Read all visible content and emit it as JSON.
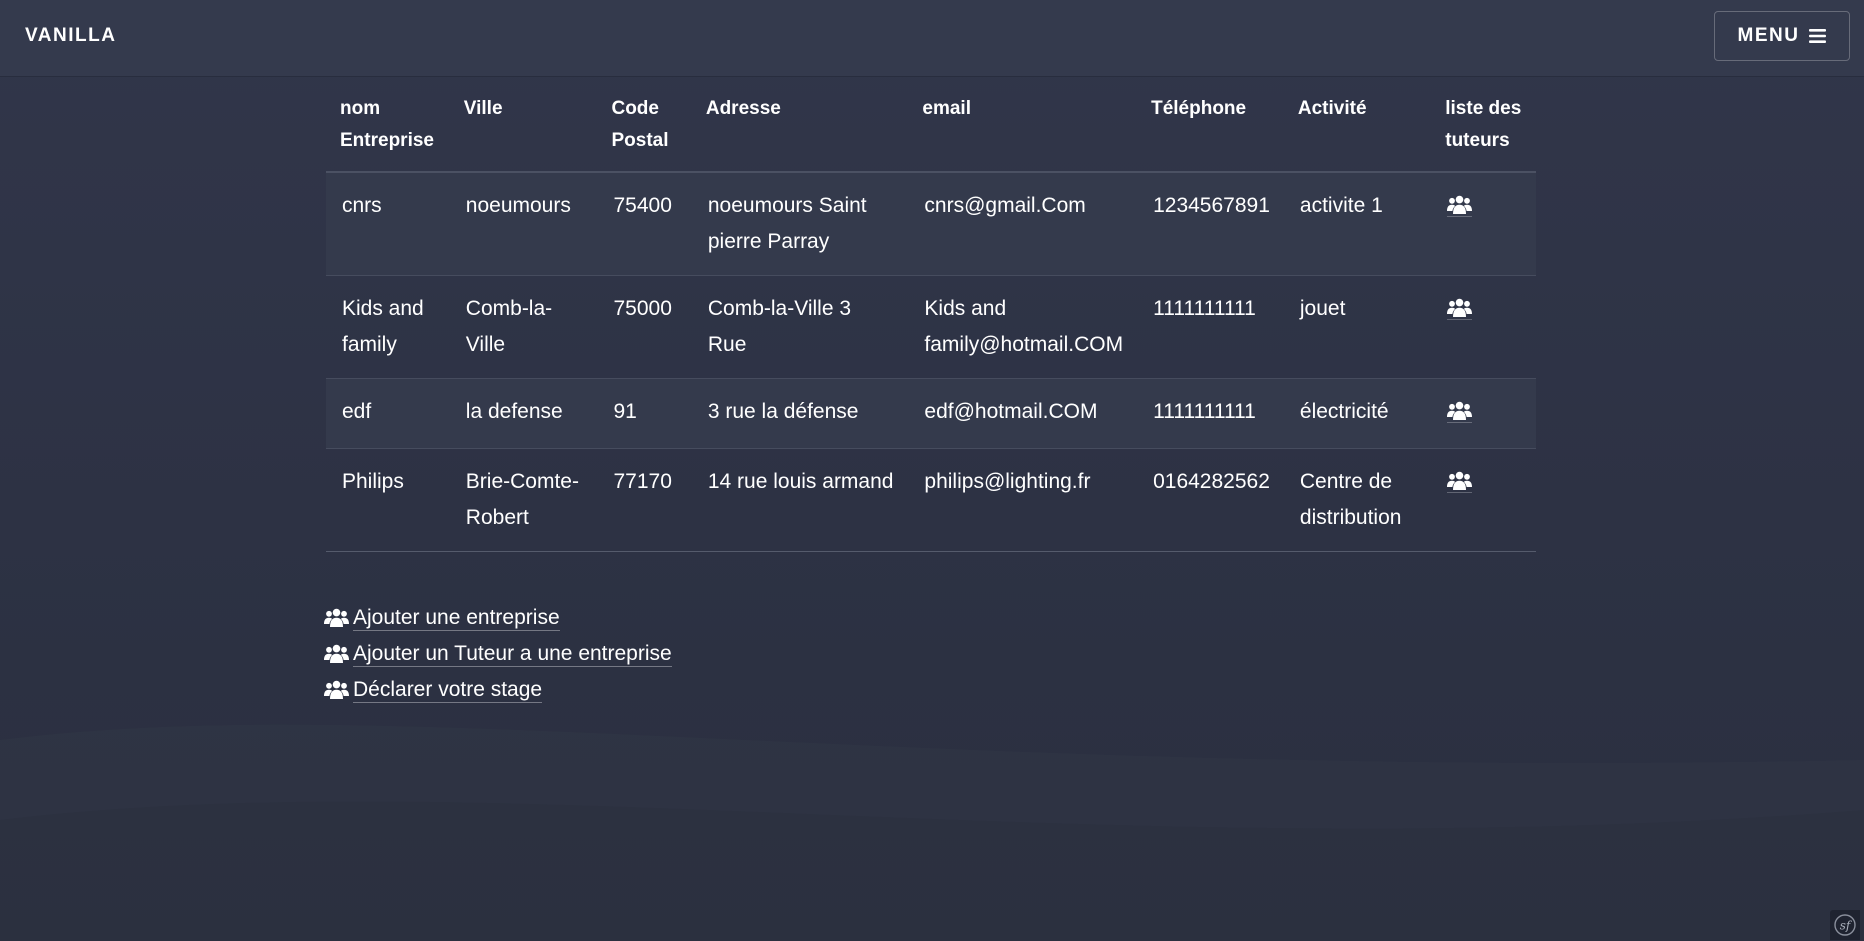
{
  "navbar": {
    "brand": "VANILLA",
    "menu_label": "MENU",
    "menu_icon": "hamburger-icon"
  },
  "table": {
    "headers": [
      "nom Entreprise",
      "Ville",
      "Code Postal",
      "Adresse",
      "email",
      "Téléphone",
      "Activité",
      "liste des tuteurs"
    ],
    "rows": [
      {
        "nom": "cnrs",
        "ville": "noeumours",
        "code": "75400",
        "adresse": "noeumours Saint pierre Parray",
        "email": "cnrs@gmail.Com",
        "tel": "1234567891",
        "activite": "activite 1",
        "tuteurs_icon": "users-icon"
      },
      {
        "nom": "Kids and family",
        "ville": "Comb-la-Ville",
        "code": "75000",
        "adresse": "Comb-la-Ville 3 Rue",
        "email": "Kids and family@hotmail.COM",
        "tel": "1111111111",
        "activite": "jouet",
        "tuteurs_icon": "users-icon"
      },
      {
        "nom": "edf",
        "ville": "la defense",
        "code": "91",
        "adresse": "3 rue la défense",
        "email": "edf@hotmail.COM",
        "tel": "1111111111",
        "activite": "électricité",
        "tuteurs_icon": "users-icon"
      },
      {
        "nom": "Philips",
        "ville": "Brie-Comte-Robert",
        "code": "77170",
        "adresse": "14 rue louis armand",
        "email": "philips@lighting.fr",
        "tel": "0164282562",
        "activite": "Centre de distribution",
        "tuteurs_icon": "users-icon"
      }
    ]
  },
  "actions": [
    {
      "label": "Ajouter une entreprise",
      "icon": "users-icon"
    },
    {
      "label": "Ajouter un Tuteur a une entreprise",
      "icon": "users-icon"
    },
    {
      "label": "Déclarer votre stage",
      "icon": "users-icon"
    }
  ],
  "toolbar_badge": {
    "icon": "symfony-icon"
  },
  "colors": {
    "background": "#2d3244",
    "navbar": "#343a4d",
    "text": "#ffffff",
    "stripe": "#343a4c"
  }
}
